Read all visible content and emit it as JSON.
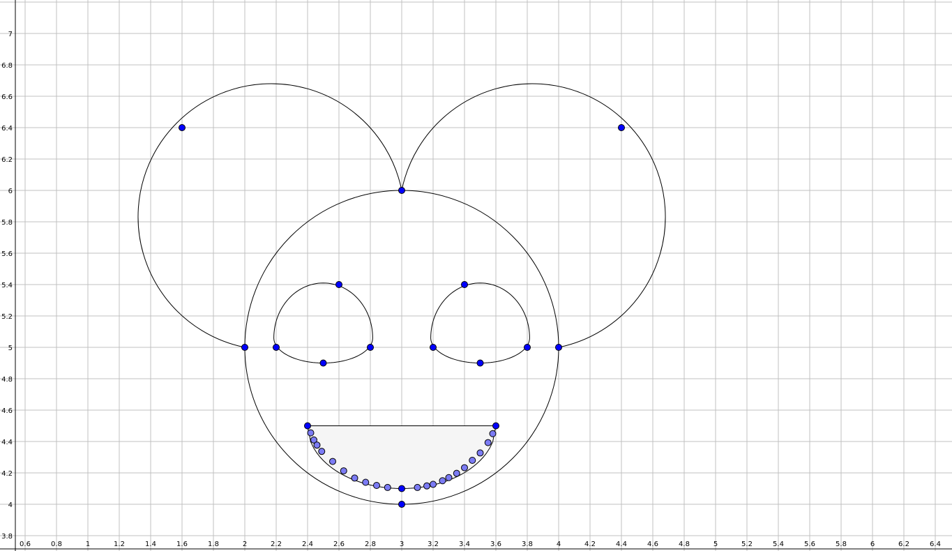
{
  "view": {
    "x_range": [
      0.4,
      6.5
    ],
    "y_range": [
      3.76,
      7.2
    ],
    "x_ticks": [
      "0.6",
      "0.8",
      "1",
      "1.2",
      "1.4",
      "1.6",
      "1.8",
      "2",
      "2.2",
      "2.4",
      "2.6",
      "2.8",
      "3",
      "3.2",
      "3.4",
      "3.6",
      "3.8",
      "4",
      "4.2",
      "4.4",
      "4.6",
      "4.8",
      "5",
      "5.2",
      "5.4",
      "5.6",
      "5.8",
      "6",
      "6.2",
      "6.4"
    ],
    "y_ticks": [
      "3.8",
      "4",
      "4.2",
      "4.4",
      "4.6",
      "4.8",
      "5",
      "5.2",
      "5.4",
      "5.6",
      "5.8",
      "6",
      "6.2",
      "6.4",
      "6.6",
      "6.8",
      "7"
    ],
    "grid": true
  },
  "colors": {
    "point": "#0000ff",
    "point_stroke": "#000000",
    "light_point": "#7b7bf4",
    "curve": "#000000",
    "mouth_fill": "#f5f5f5"
  },
  "shapes": {
    "face_circle": {
      "center": [
        3,
        5
      ],
      "radius": 1
    },
    "left_ear_arc": {
      "center": [
        2.2,
        5.8
      ],
      "radius": 0.8485,
      "through": [
        [
          2,
          5
        ],
        [
          1.6,
          6.4
        ],
        [
          3,
          6
        ]
      ]
    },
    "right_ear_arc": {
      "center": [
        3.8,
        5.8
      ],
      "radius": 0.8485,
      "through": [
        [
          3,
          6
        ],
        [
          4.4,
          6.4
        ],
        [
          4,
          5
        ]
      ]
    },
    "left_eye_arc": {
      "through": [
        [
          2.2,
          5
        ],
        [
          2.5,
          4.9
        ],
        [
          2.8,
          5
        ],
        [
          2.6,
          5.4
        ]
      ]
    },
    "right_eye_arc": {
      "through": [
        [
          3.2,
          5
        ],
        [
          3.5,
          4.9
        ],
        [
          3.8,
          5
        ],
        [
          3.4,
          5.4
        ]
      ]
    },
    "mouth": {
      "top_left": [
        2.4,
        4.5
      ],
      "top_right": [
        3.6,
        4.5
      ],
      "bottom": [
        3,
        4.1
      ]
    }
  },
  "points": [
    [
      1.6,
      6.4
    ],
    [
      4.4,
      6.4
    ],
    [
      3,
      6
    ],
    [
      2,
      5
    ],
    [
      4,
      5
    ],
    [
      2.2,
      5
    ],
    [
      2.8,
      5
    ],
    [
      2.6,
      5.4
    ],
    [
      2.5,
      4.9
    ],
    [
      3.2,
      5
    ],
    [
      3.8,
      5
    ],
    [
      3.4,
      5.4
    ],
    [
      3.5,
      4.9
    ],
    [
      2.4,
      4.5
    ],
    [
      3.6,
      4.5
    ],
    [
      3,
      4.1
    ],
    [
      3,
      4
    ]
  ],
  "mouth_points": [
    [
      2.42,
      4.455
    ],
    [
      2.44,
      4.41
    ],
    [
      2.46,
      4.377
    ],
    [
      2.49,
      4.337
    ],
    [
      2.56,
      4.273
    ],
    [
      2.63,
      4.213
    ],
    [
      2.7,
      4.167
    ],
    [
      2.77,
      4.14
    ],
    [
      2.84,
      4.12
    ],
    [
      2.91,
      4.107
    ],
    [
      3.1,
      4.107
    ],
    [
      3.16,
      4.117
    ],
    [
      3.2,
      4.127
    ],
    [
      3.26,
      4.15
    ],
    [
      3.3,
      4.17
    ],
    [
      3.35,
      4.197
    ],
    [
      3.4,
      4.233
    ],
    [
      3.45,
      4.28
    ],
    [
      3.5,
      4.327
    ],
    [
      3.55,
      4.393
    ],
    [
      3.58,
      4.45
    ]
  ]
}
